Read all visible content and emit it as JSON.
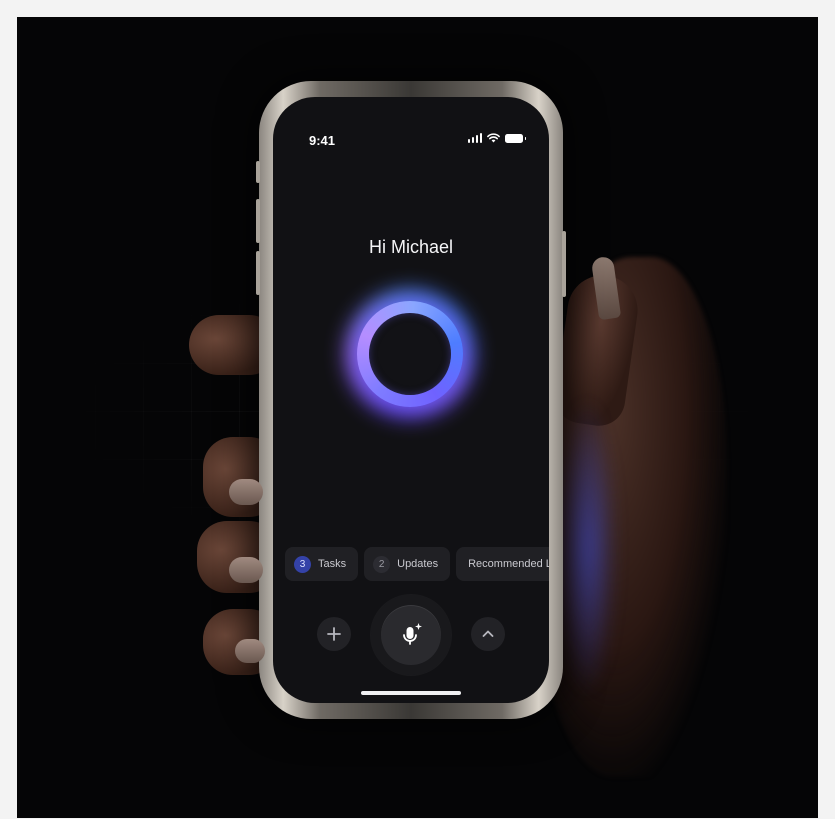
{
  "status_bar": {
    "time": "9:41"
  },
  "greeting": "Hi Michael",
  "chips": [
    {
      "count": "3",
      "label": "Tasks",
      "accent": true
    },
    {
      "count": "2",
      "label": "Updates",
      "accent": false
    },
    {
      "label": "Recommended Le"
    }
  ],
  "controls": {
    "add_icon": "plus-icon",
    "mic_icon": "microphone-sparkle-icon",
    "expand_icon": "chevron-up-icon"
  },
  "colors": {
    "orb_primary": "#7f7cff",
    "orb_secondary": "#4e7dff",
    "chip_accent": "#3442a8"
  }
}
